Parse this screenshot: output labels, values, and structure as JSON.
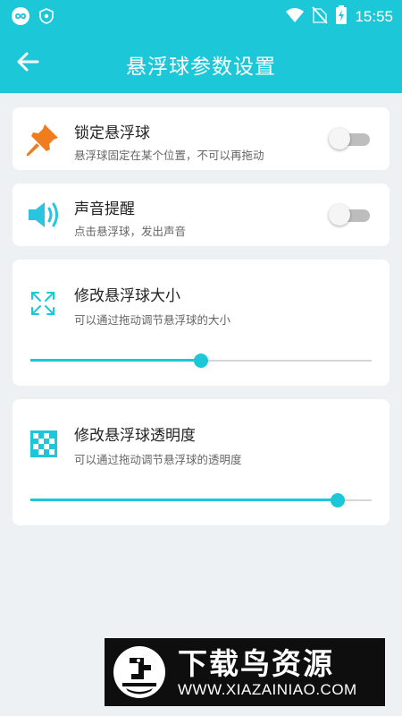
{
  "status_bar": {
    "time": "15:55",
    "left_icons": [
      "infinity-icon",
      "shield-icon"
    ],
    "right_icons": [
      "wifi-icon",
      "no-signal-icon",
      "battery-charging-icon"
    ]
  },
  "app_bar": {
    "title": "悬浮球参数设置",
    "back_icon": "back-arrow-icon"
  },
  "settings": {
    "lock": {
      "icon": "pushpin-icon",
      "title": "锁定悬浮球",
      "description": "悬浮球固定在某个位置，不可以再拖动",
      "enabled": false
    },
    "sound": {
      "icon": "speaker-icon",
      "title": "声音提醒",
      "description": "点击悬浮球，发出声音",
      "enabled": false
    },
    "size": {
      "icon": "resize-arrows-icon",
      "title": "修改悬浮球大小",
      "description": "可以通过拖动调节悬浮球的大小",
      "value": 0.5
    },
    "opacity": {
      "icon": "transparency-checker-icon",
      "title": "修改悬浮球透明度",
      "description": "可以通过拖动调节悬浮球的透明度",
      "value": 0.9
    }
  },
  "watermark": {
    "title": "下载鸟资源",
    "url": "WWW.XIAZAINIAO.COM"
  },
  "colors": {
    "accent": "#1cc7d8",
    "pin": "#f07c1e",
    "speaker": "#29c4e0",
    "background": "#eef1f4"
  }
}
